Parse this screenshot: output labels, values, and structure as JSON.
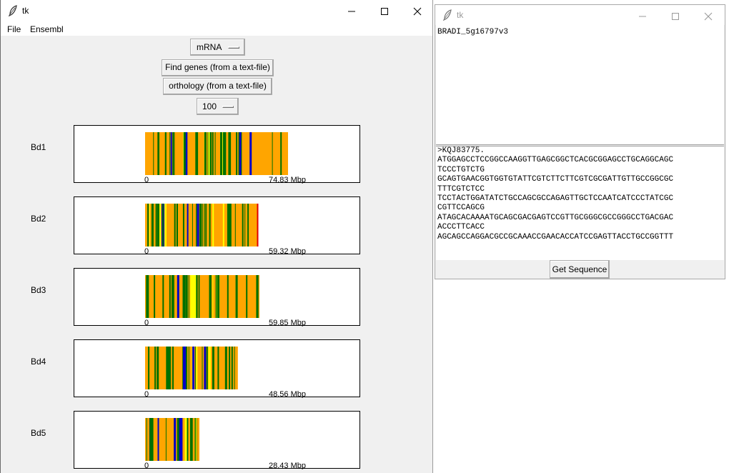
{
  "main_window": {
    "title": "tk",
    "menu": [
      "File",
      "Ensembl"
    ],
    "sequence_type": "mRNA",
    "find_genes_label": "Find genes (from a text-file)",
    "orthology_label": "orthology (from a text-file)",
    "window_size": "100"
  },
  "chromosomes": [
    {
      "name": "Bd1",
      "start_label": "0",
      "end_label": "74.83 Mbp",
      "length_mbp": 74.83
    },
    {
      "name": "Bd2",
      "start_label": "0",
      "end_label": "59.32 Mbp",
      "length_mbp": 59.32
    },
    {
      "name": "Bd3",
      "start_label": "0",
      "end_label": "59.85 Mbp",
      "length_mbp": 59.85
    },
    {
      "name": "Bd4",
      "start_label": "0",
      "end_label": "48.56 Mbp",
      "length_mbp": 48.56
    },
    {
      "name": "Bd5",
      "start_label": "0",
      "end_label": "28.43 Mbp",
      "length_mbp": 28.43
    }
  ],
  "colors": {
    "base": "#ffa500",
    "green": "#007000",
    "yellow": "#ffff00",
    "blue": "#0000c8",
    "red": "#e00000"
  },
  "sequence_window": {
    "title": "tk",
    "gene_id": "BRADI_5g16797v3",
    "sequence_lines": [
      ">KQJ83775.",
      "ATGGAGCCTCCGGCCAAGGTTGAGCGGCTCACGCGGAGCCTGCAGGCAGC",
      "TCCCTGTCTG",
      "GCAGTGAACGGTGGTGTATTCGTCTTCTTCGTCGCGATTGTTGCCGGCGC",
      "TTTCGTCTCC",
      "TCCTACTGGATATCTGCCAGCGCCAGAGTTGCTCCAATCATCCCTATCGC",
      "CGTTCCAGCG",
      "ATAGCACAAAATGCAGCGACGAGTCCGTTGCGGGCGCCGGGCCTGACGAC",
      "ACCCTTCACC",
      "AGCAGCCAGGACGCCGCAAACCGAACACCATCCGAGTTACCTGCCGGTTT"
    ],
    "get_sequence_label": "Get Sequence"
  }
}
